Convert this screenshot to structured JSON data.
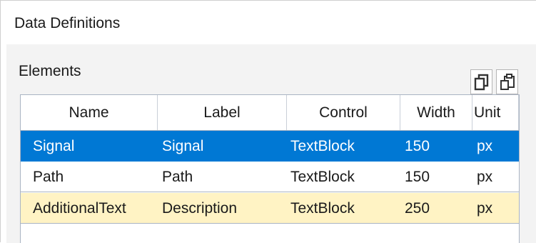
{
  "window": {
    "title": "Data Definitions"
  },
  "panel": {
    "elements_label": "Elements"
  },
  "toolbar": {
    "copy_icon": "copy-icon",
    "paste_icon": "paste-icon"
  },
  "grid": {
    "columns": [
      "Name",
      "Label",
      "Control",
      "Width",
      "Unit"
    ],
    "rows": [
      {
        "name": "Signal",
        "label": "Signal",
        "control": "TextBlock",
        "width": "150",
        "unit": "px",
        "state": "selected"
      },
      {
        "name": "Path",
        "label": "Path",
        "control": "TextBlock",
        "width": "150",
        "unit": "px",
        "state": "normal"
      },
      {
        "name": "AdditionalText",
        "label": "Description",
        "control": "TextBlock",
        "width": "250",
        "unit": "px",
        "state": "highlighted"
      }
    ]
  },
  "colors": {
    "selection": "#0078d4",
    "highlight_row": "#fff3c4",
    "panel_bg": "#f3f3f3"
  }
}
